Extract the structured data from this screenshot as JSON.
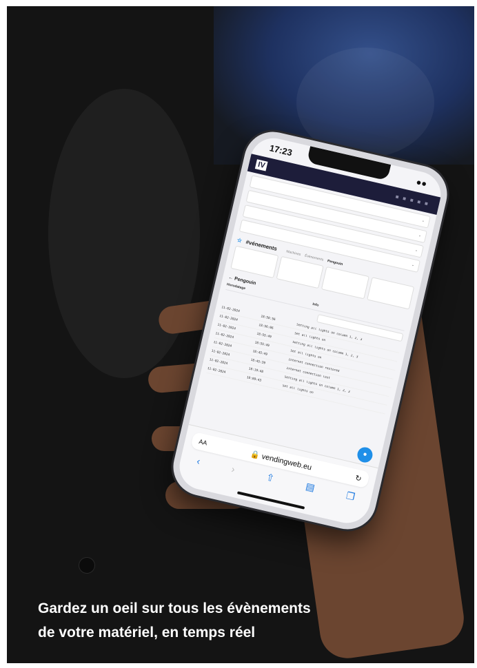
{
  "caption": {
    "line1": "Gardez un oeil sur tous les évènements",
    "line2": "de votre matériel, en temps réel"
  },
  "phone": {
    "time": "17:23",
    "url": "vendingweb.eu",
    "text_size_label": "AA",
    "app": {
      "logo": "IV",
      "section_title": "#vénements",
      "tabs": [
        "Machines",
        "Évènements",
        "Pengouin"
      ],
      "active_tab": "Pengouin",
      "subheading": "Pengouin",
      "columns": [
        "Horodatage",
        "Info"
      ],
      "rows": [
        {
          "date": "11-02-2024",
          "time": "18:58:56",
          "info": "Setting all lights on column 1, 2, 3"
        },
        {
          "date": "11-02-2024",
          "time": "18:56:06",
          "info": "Set all lights on"
        },
        {
          "date": "11-02-2024",
          "time": "18:55:49",
          "info": "Setting all lights on column 1, 2, 3"
        },
        {
          "date": "11-02-2024",
          "time": "18:55:49",
          "info": "Set all lights on"
        },
        {
          "date": "11-02-2024",
          "time": "18:45:49",
          "info": "Internet connection restored"
        },
        {
          "date": "11-02-2024",
          "time": "18:45:39",
          "info": "Internet connection lost"
        },
        {
          "date": "11-02-2024",
          "time": "18:19:48",
          "info": "Setting all lights on column 1, 2, 3"
        },
        {
          "date": "11-02-2024",
          "time": "18:09:43",
          "info": "Set all lights on"
        }
      ]
    }
  },
  "colors": {
    "accent": "#1f8fe8",
    "appbar": "#1d1d3a",
    "safari_blue": "#1f7ae0"
  }
}
